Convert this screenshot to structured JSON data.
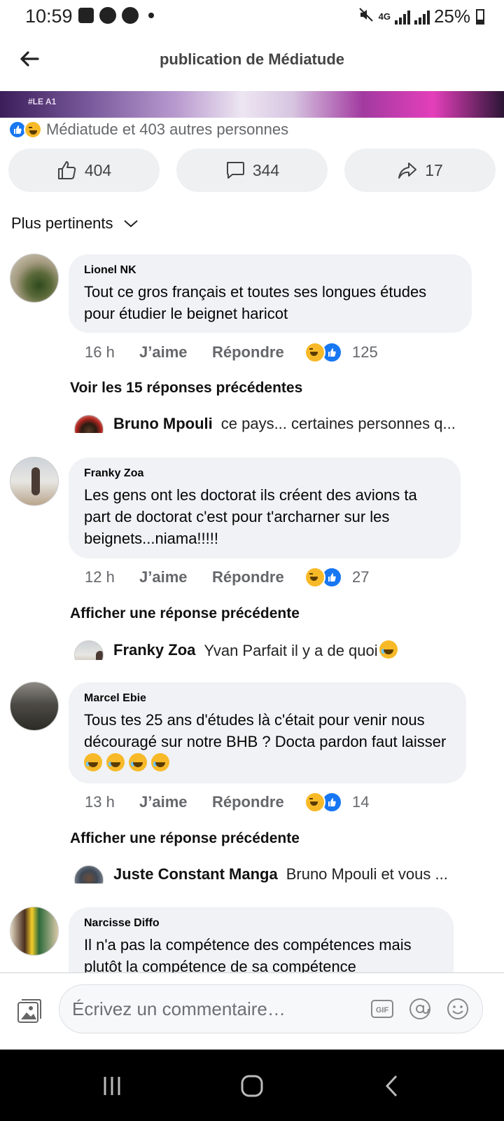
{
  "status_bar": {
    "time": "10:59",
    "network": "4G",
    "battery": "25%"
  },
  "header": {
    "title": "publication de Médiatude"
  },
  "banner": {
    "tag": "#LE A1"
  },
  "reactions": {
    "summary": "Médiatude et 403 autres personnes"
  },
  "actions": {
    "like_count": "404",
    "comment_count": "344",
    "share_count": "17"
  },
  "sort": {
    "label": "Plus pertinents"
  },
  "comments": [
    {
      "author": "Lionel NK",
      "text": "Tout ce gros français et toutes ses longues études pour étudier le beignet haricot",
      "time": "16 h",
      "like_label": "J’aime",
      "reply_label": "Répondre",
      "reaction_count": "125",
      "previous_replies": "Voir les 15 réponses précédentes",
      "reply": {
        "author": "Bruno Mpouli",
        "text": "ce pays... certaines personnes q..."
      }
    },
    {
      "author": "Franky Zoa",
      "text": "Les gens ont les doctorat ils créent des avions ta part de doctorat c'est pour t'archarner sur les beignets...niama!!!!!",
      "time": "12 h",
      "like_label": "J’aime",
      "reply_label": "Répondre",
      "reaction_count": "27",
      "previous_replies": "Afficher une réponse précédente",
      "reply": {
        "author": "Franky Zoa",
        "text": "Yvan Parfait il y a de quoi"
      }
    },
    {
      "author": "Marcel Ebie",
      "text": "Tous tes 25 ans d'études là c'était pour venir nous découragé sur notre BHB ? Docta pardon faut laisser",
      "time": "13 h",
      "like_label": "J’aime",
      "reply_label": "Répondre",
      "reaction_count": "14",
      "previous_replies": "Afficher une réponse précédente",
      "reply": {
        "author": "Juste Constant Manga",
        "text": "Bruno Mpouli et vous ..."
      }
    },
    {
      "author": "Narcisse Diffo",
      "text": "Il n'a pas la compétence des compétences mais plutôt la compétence de sa compétence"
    }
  ],
  "composer": {
    "placeholder": "Écrivez un commentaire…",
    "gif_label": "GIF"
  },
  "colors": {
    "like_blue": "#1877f2",
    "haha_yellow": "#f7b928",
    "bubble_bg": "#f0f2f5",
    "meta_gray": "#65676b"
  }
}
